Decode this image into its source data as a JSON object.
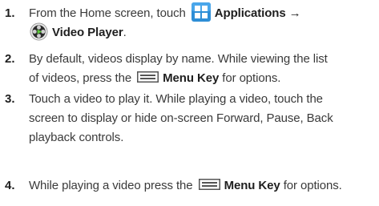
{
  "steps": [
    {
      "number": "1.",
      "pre": "From the Home screen, touch",
      "apps_label": "Applications →",
      "video_label": "Video Player",
      "end": "."
    },
    {
      "number": "2.",
      "line1": "By default, videos display by name. While viewing the list",
      "pre": "of videos, press the",
      "menu_label": "Menu Key",
      "post": "for options."
    },
    {
      "number": "3.",
      "line1": "Touch a video to play it. While playing a video, touch the",
      "line2": "screen to display or hide on-screen Forward, Pause, Back",
      "line3": "playback controls."
    },
    {
      "number": "4.",
      "pre": "While playing a video press the",
      "menu_label": "Menu Key",
      "post": "for options."
    }
  ],
  "icons": {
    "applications": "applications-icon",
    "video_player": "video-player-icon",
    "menu_key": "menu-key-icon"
  },
  "colors": {
    "applications_icon": "#2e8ed6",
    "menu_icon": "#555555"
  }
}
